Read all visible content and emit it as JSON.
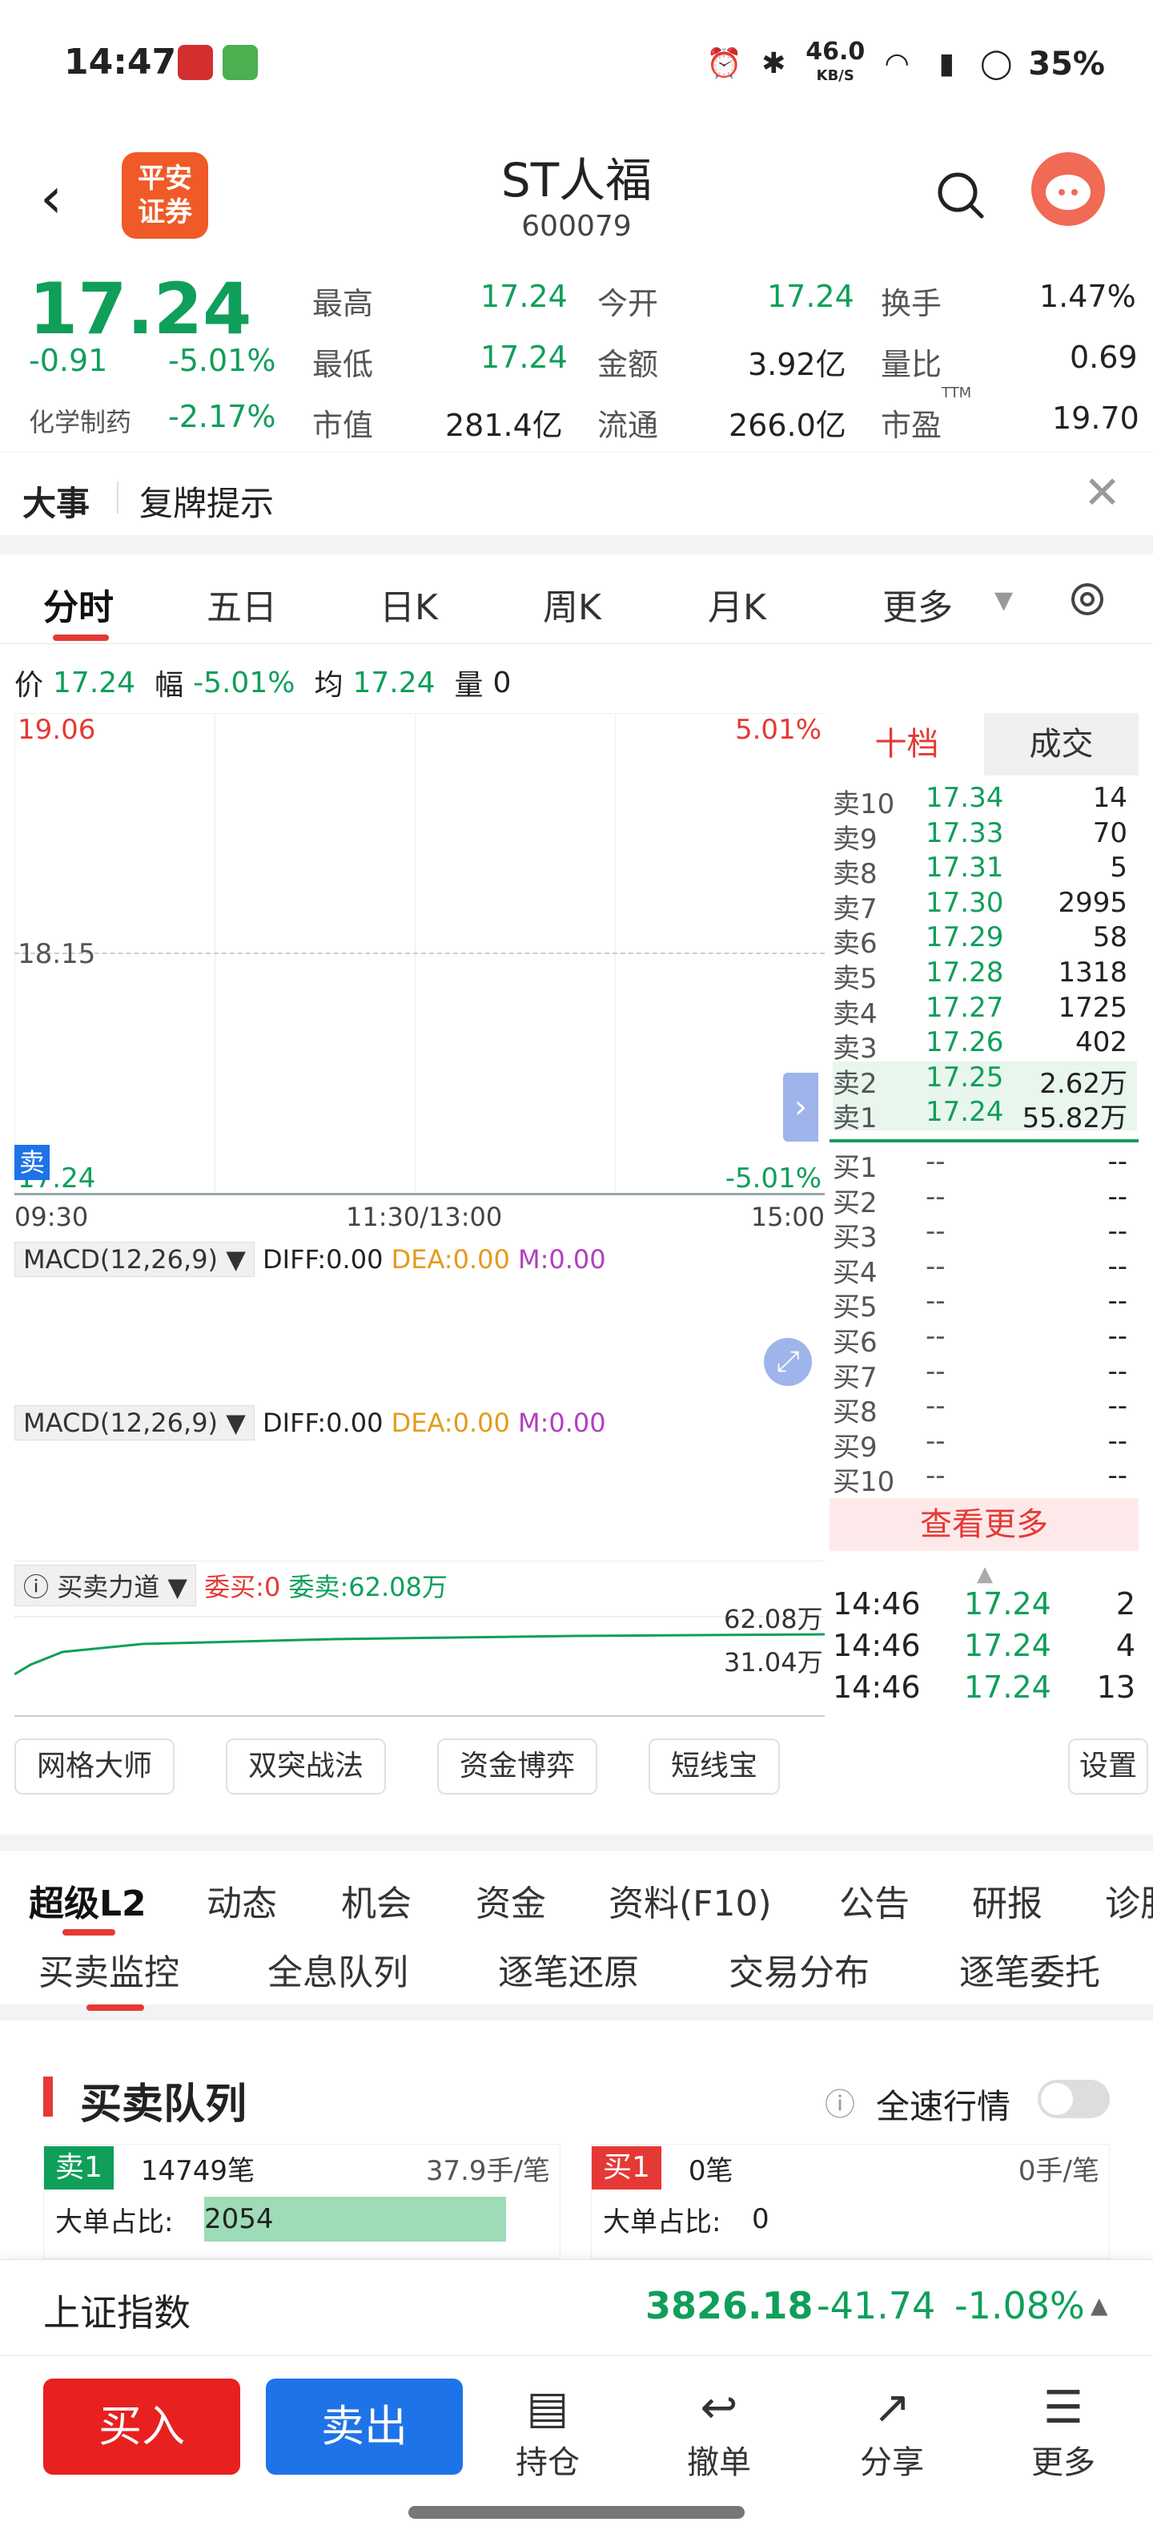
{
  "status": {
    "time": "14:47",
    "net_speed": "46.0",
    "net_unit": "KB/S",
    "battery": "35%"
  },
  "header": {
    "logo_line1": "平安",
    "logo_line2": "证券",
    "title": "ST人福",
    "code": "600079"
  },
  "quote": {
    "price": "17.24",
    "change": "-0.91",
    "change_pct": "-5.01%",
    "sector": "化学制药",
    "sector_pct": "-2.17%",
    "cells": [
      {
        "label": "最高",
        "value": "17.24"
      },
      {
        "label": "今开",
        "value": "17.24"
      },
      {
        "label": "换手",
        "value": "1.47%"
      },
      {
        "label": "最低",
        "value": "17.24"
      },
      {
        "label": "金额",
        "value": "3.92亿"
      },
      {
        "label": "量比",
        "value": "0.69"
      },
      {
        "label": "市值",
        "value": "281.4亿"
      },
      {
        "label": "流通",
        "value": "266.0亿"
      },
      {
        "label": "市盈",
        "value": "19.70"
      }
    ],
    "ttm": "TTM"
  },
  "event": {
    "label": "大事",
    "text": "复牌提示"
  },
  "chart_tabs": [
    "分时",
    "五日",
    "日K",
    "周K",
    "月K",
    "更多"
  ],
  "price_info": {
    "p_label": "价",
    "p": "17.24",
    "f_label": "幅",
    "f": "-5.01%",
    "avg_label": "均",
    "avg": "17.24",
    "vol_label": "量",
    "vol": "0"
  },
  "chart": {
    "top_price": "19.06",
    "top_pct": "5.01%",
    "mid_price": "18.15",
    "bottom_price": "17.24",
    "bottom_pct": "-5.01%",
    "sell_tag": "卖",
    "times": [
      "09:30",
      "11:30/13:00",
      "15:00"
    ]
  },
  "book": {
    "tab1": "十档",
    "tab2": "成交",
    "sells": [
      {
        "n": "卖10",
        "p": "17.34",
        "v": "14"
      },
      {
        "n": "卖9",
        "p": "17.33",
        "v": "70"
      },
      {
        "n": "卖8",
        "p": "17.31",
        "v": "5"
      },
      {
        "n": "卖7",
        "p": "17.30",
        "v": "2995"
      },
      {
        "n": "卖6",
        "p": "17.29",
        "v": "58"
      },
      {
        "n": "卖5",
        "p": "17.28",
        "v": "1318"
      },
      {
        "n": "卖4",
        "p": "17.27",
        "v": "1725"
      },
      {
        "n": "卖3",
        "p": "17.26",
        "v": "402"
      },
      {
        "n": "卖2",
        "p": "17.25",
        "v": "2.62万"
      },
      {
        "n": "卖1",
        "p": "17.24",
        "v": "55.82万"
      }
    ],
    "buys": [
      {
        "n": "买1",
        "p": "--",
        "v": "--"
      },
      {
        "n": "买2",
        "p": "--",
        "v": "--"
      },
      {
        "n": "买3",
        "p": "--",
        "v": "--"
      },
      {
        "n": "买4",
        "p": "--",
        "v": "--"
      },
      {
        "n": "买5",
        "p": "--",
        "v": "--"
      },
      {
        "n": "买6",
        "p": "--",
        "v": "--"
      },
      {
        "n": "买7",
        "p": "--",
        "v": "--"
      },
      {
        "n": "买8",
        "p": "--",
        "v": "--"
      },
      {
        "n": "买9",
        "p": "--",
        "v": "--"
      },
      {
        "n": "买10",
        "p": "--",
        "v": "--"
      }
    ],
    "more": "查看更多",
    "trades": [
      {
        "t": "14:46",
        "p": "17.24",
        "v": "2"
      },
      {
        "t": "14:46",
        "p": "17.24",
        "v": "4"
      },
      {
        "t": "14:46",
        "p": "17.24",
        "v": "13"
      }
    ]
  },
  "macd": {
    "name": "MACD(12,26,9)",
    "diff": "DIFF:0.00",
    "dea": "DEA:0.00",
    "m": "M:0.00"
  },
  "force": {
    "name": "买卖力道",
    "wb": "委买:0",
    "ws": "委卖:62.08万",
    "v1": "62.08万",
    "v2": "31.04万"
  },
  "tools": [
    "网格大师",
    "双突战法",
    "资金博弈",
    "短线宝",
    "设置"
  ],
  "l2tabs": [
    "超级L2",
    "动态",
    "机会",
    "资金",
    "资料(F10)",
    "公告",
    "研报",
    "诊股"
  ],
  "subtabs": [
    "买卖监控",
    "全息队列",
    "逐笔还原",
    "交易分布",
    "逐笔委托"
  ],
  "queue": {
    "title": "买卖队列",
    "fast": "全速行情",
    "left": {
      "tag": "卖1",
      "count": "14749笔",
      "avg": "37.9手/笔",
      "big_label": "大单占比:",
      "big": "2054",
      "big_fill": 0.85
    },
    "right": {
      "tag": "买1",
      "count": "0笔",
      "avg": "0手/笔",
      "big_label": "大单占比:",
      "big": "0"
    }
  },
  "index": {
    "name": "上证指数",
    "value": "3826.18",
    "change": "-41.74",
    "pct": "-1.08%"
  },
  "bottom": {
    "buy": "买入",
    "sell": "卖出",
    "hold": "持仓",
    "cancel": "撤单",
    "share": "分享",
    "more": "更多"
  },
  "colors": {
    "green": "#0f9f5a",
    "red": "#e53935",
    "blue": "#1e73e8",
    "brand": "#f05a28"
  }
}
